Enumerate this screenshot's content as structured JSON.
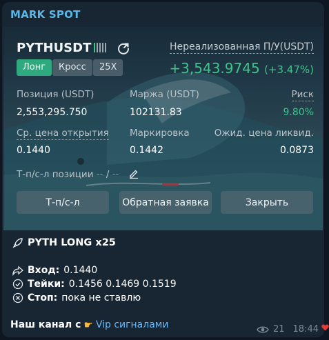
{
  "channel": {
    "name": "MARK SPOT"
  },
  "position": {
    "pair": "PYTHUSDT",
    "tags": {
      "side": "Лонг",
      "margin_mode": "Кросс",
      "leverage": "25X"
    },
    "pnl": {
      "label": "Нереализованная П/У(USDT)",
      "value": "+3,543.9745",
      "pct": "(+3.47%)"
    },
    "fields": {
      "size_label": "Позиция (USDT)",
      "size_value": "2,553,295.750",
      "margin_label": "Маржа (USDT)",
      "margin_value": "102131.83",
      "risk_label": "Риск",
      "risk_value": "9.80%",
      "entry_label": "Ср. цена открытия",
      "entry_value": "0.1440",
      "mark_label": "Маркировка",
      "mark_value": "0.1442",
      "liq_label": "Ожид. цена ликвид.",
      "liq_value": "0.0873"
    },
    "tpsl": {
      "label": "Т-п/с-л позиции",
      "tp": "--",
      "sep": "/",
      "sl": "--"
    },
    "buttons": {
      "tpsl": "Т-п/с-л",
      "reverse": "Обратная заявка",
      "close": "Закрыть"
    }
  },
  "message": {
    "title": "PYTH LONG x25",
    "entry_label": "Вход:",
    "entry_value": "0.1440",
    "takes_label": "Тейки:",
    "takes_value": "0.1456 0.1469 0.1519",
    "stop_label": "Стоп:",
    "stop_value": "пока не ставлю",
    "promo_text": "Наш канал с",
    "promo_link": "Vip сигналами",
    "views": "21",
    "time": "18:44"
  },
  "colors": {
    "accent": "#3fc48a",
    "link": "#6ab7f5",
    "channel": "#5bb8e6"
  },
  "icons": [
    "share-icon",
    "edit-icon",
    "rocket-icon",
    "forward-icon",
    "check-circle-icon",
    "x-circle-icon",
    "pointing-hand-icon",
    "eye-icon",
    "heart-icon"
  ]
}
